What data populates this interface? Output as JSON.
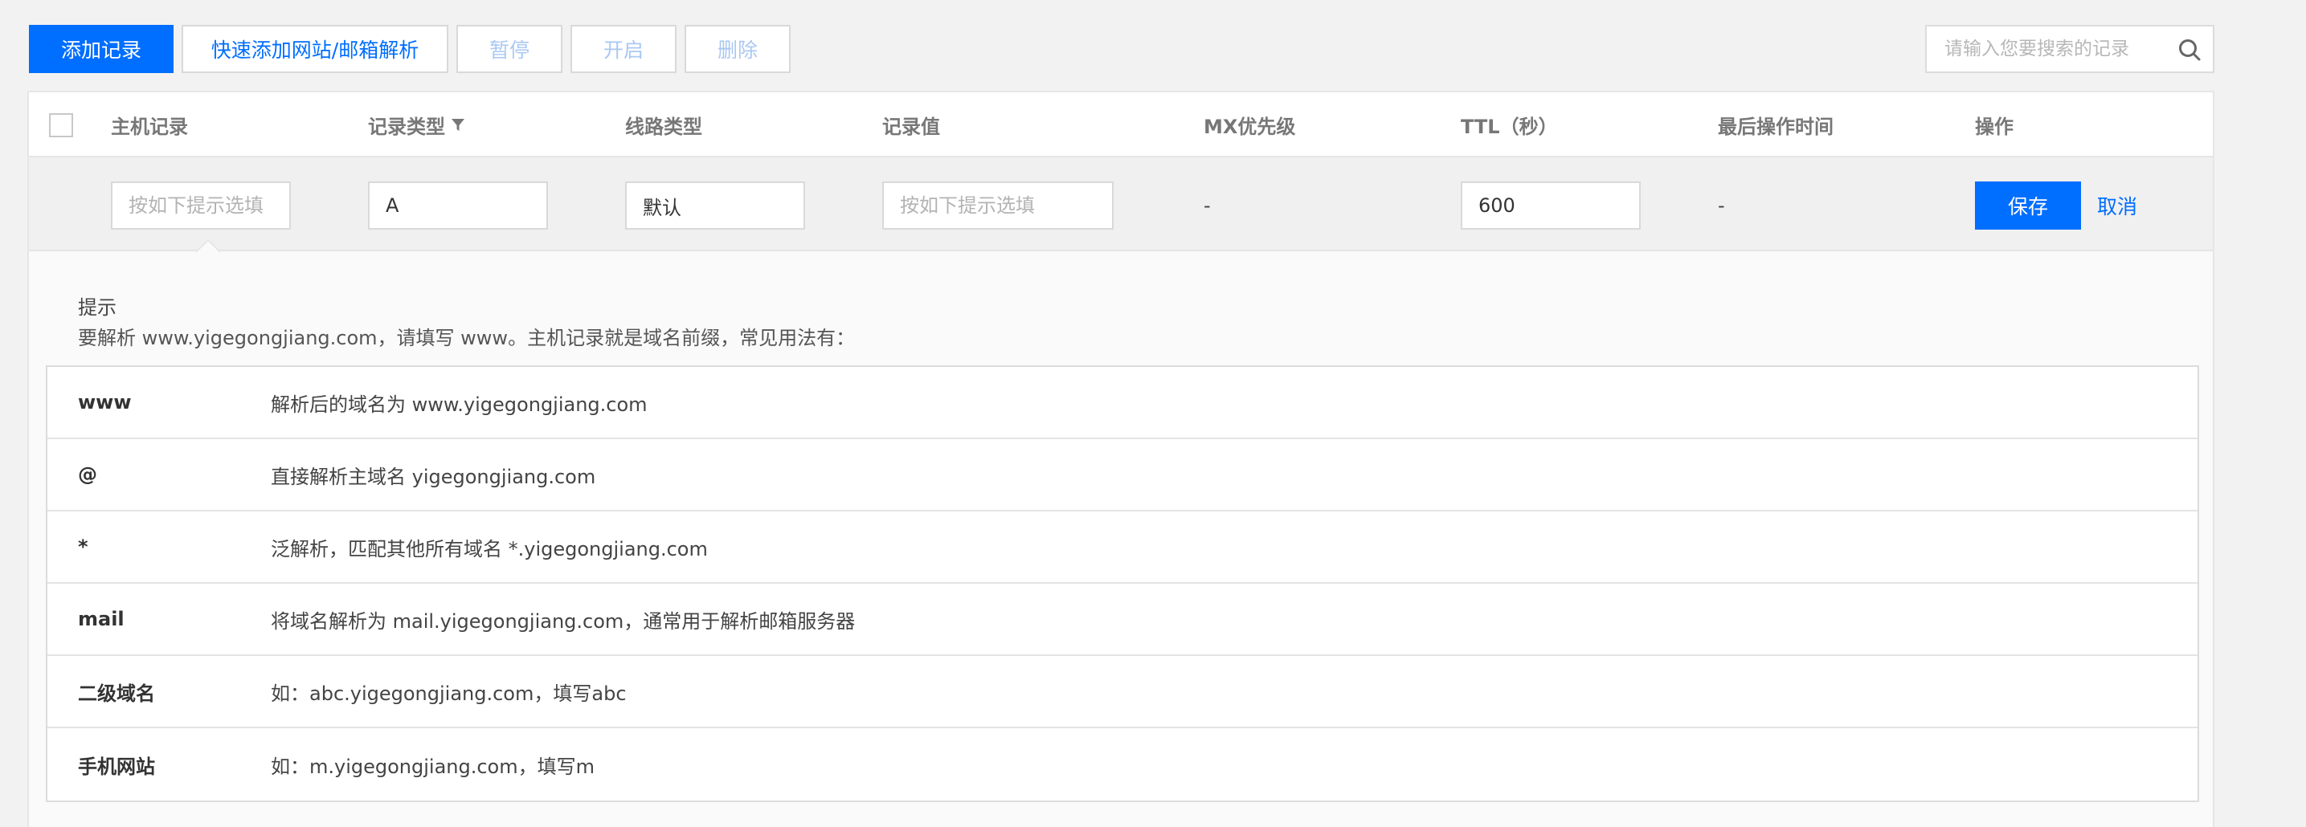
{
  "toolbar": {
    "add_record": "添加记录",
    "quick_add": "快速添加网站/邮箱解析",
    "pause": "暂停",
    "enable": "开启",
    "delete": "删除"
  },
  "search": {
    "placeholder": "请输入您要搜索的记录"
  },
  "table": {
    "headers": {
      "host": "主机记录",
      "type": "记录类型",
      "line": "线路类型",
      "value": "记录值",
      "mx": "MX优先级",
      "ttl": "TTL（秒）",
      "last_op": "最后操作时间",
      "actions": "操作"
    },
    "edit_row": {
      "host_placeholder": "按如下提示选填",
      "type_value": "A",
      "line_value": "默认",
      "value_placeholder": "按如下提示选填",
      "mx": "-",
      "ttl_value": "600",
      "last_op": "-",
      "save": "保存",
      "cancel": "取消"
    }
  },
  "tips": {
    "title": "提示",
    "description": "要解析 www.yigegongjiang.com，请填写 www。主机记录就是域名前缀，常见用法有：",
    "rows": [
      {
        "key": "www",
        "desc": "解析后的域名为 www.yigegongjiang.com"
      },
      {
        "key": "@",
        "desc": "直接解析主域名 yigegongjiang.com"
      },
      {
        "key": "*",
        "desc": "泛解析，匹配其他所有域名 *.yigegongjiang.com"
      },
      {
        "key": "mail",
        "desc": "将域名解析为 mail.yigegongjiang.com，通常用于解析邮箱服务器"
      },
      {
        "key": "二级域名",
        "desc": "如：abc.yigegongjiang.com，填写abc"
      },
      {
        "key": "手机网站",
        "desc": "如：m.yigegongjiang.com，填写m"
      }
    ]
  },
  "colors": {
    "primary": "#006eff",
    "disabled_text": "#a9c8f2",
    "background": "#f2f2f2"
  }
}
